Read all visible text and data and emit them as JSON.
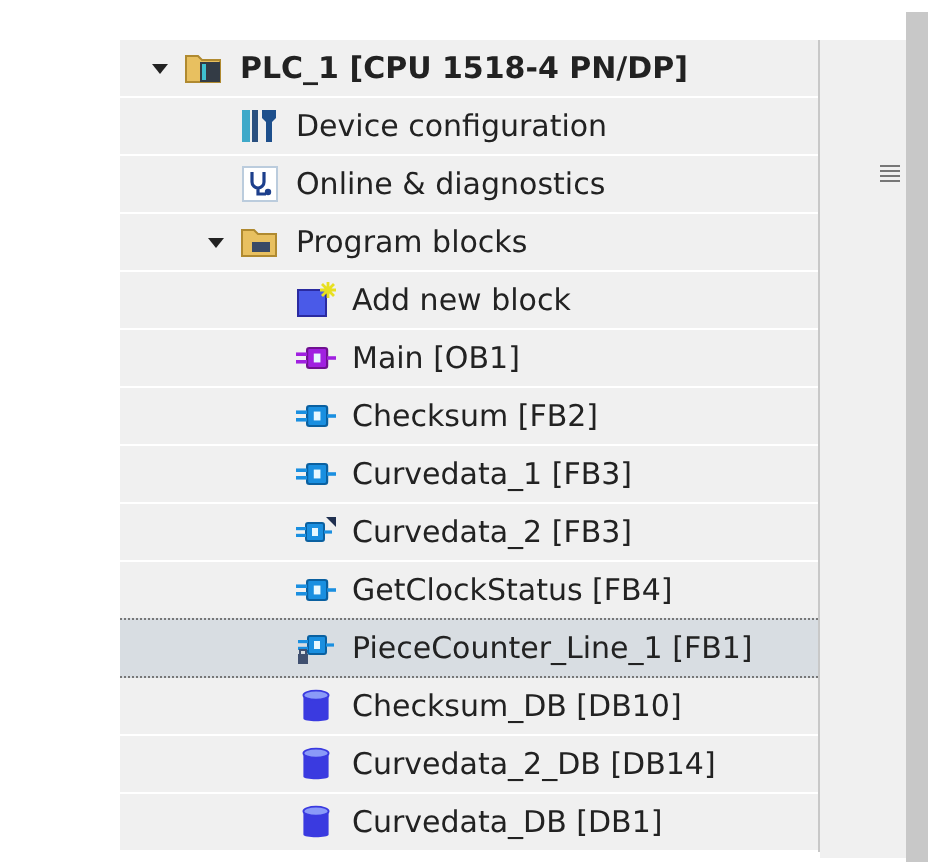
{
  "tree": [
    {
      "label": "PLC_1 [CPU 1518-4 PN/DP]",
      "kind": "plc",
      "expanded": true,
      "selected": false,
      "children": [
        {
          "label": "Device configuration",
          "kind": "device",
          "selected": false
        },
        {
          "label": "Online & diagnostics",
          "kind": "diagnostics",
          "selected": false
        },
        {
          "label": "Program blocks",
          "kind": "folder",
          "expanded": true,
          "selected": false,
          "children": [
            {
              "label": "Add new block",
              "kind": "add",
              "selected": false
            },
            {
              "label": "Main [OB1]",
              "kind": "ob",
              "selected": false
            },
            {
              "label": "Checksum [FB2]",
              "kind": "fb",
              "selected": false
            },
            {
              "label": "Curvedata_1 [FB3]",
              "kind": "fb",
              "selected": false
            },
            {
              "label": "Curvedata_2 [FB3]",
              "kind": "fb-marked",
              "selected": false
            },
            {
              "label": "GetClockStatus [FB4]",
              "kind": "fb",
              "selected": false
            },
            {
              "label": "PieceCounter_Line_1 [FB1]",
              "kind": "fb-locked",
              "selected": true
            },
            {
              "label": "Checksum_DB [DB10]",
              "kind": "db",
              "selected": false
            },
            {
              "label": "Curvedata_2_DB [DB14]",
              "kind": "db",
              "selected": false
            },
            {
              "label": "Curvedata_DB [DB1]",
              "kind": "db",
              "selected": false
            }
          ]
        }
      ]
    }
  ]
}
